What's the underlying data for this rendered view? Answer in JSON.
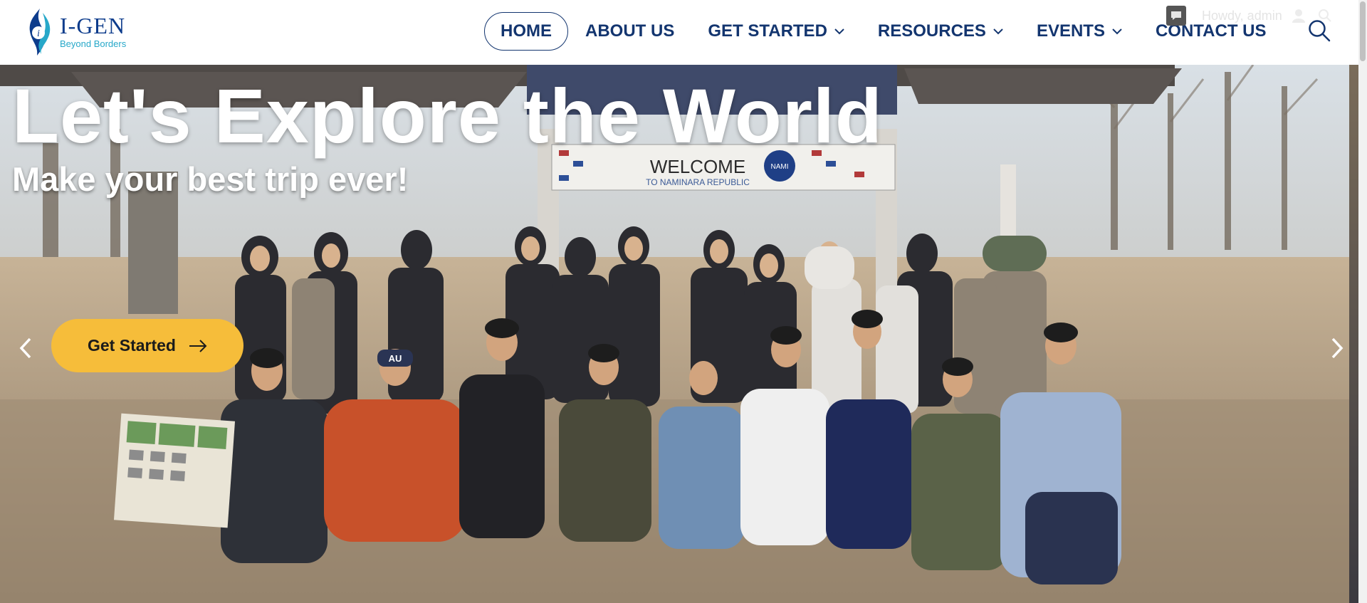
{
  "brand": {
    "name": "I-GEN",
    "tagline": "Beyond Borders"
  },
  "nav": {
    "items": [
      {
        "label": "HOME",
        "active": true
      },
      {
        "label": "ABOUT US",
        "has_dropdown": false
      },
      {
        "label": "GET STARTED",
        "has_dropdown": true
      },
      {
        "label": "RESOURCES",
        "has_dropdown": true
      },
      {
        "label": "EVENTS",
        "has_dropdown": true
      },
      {
        "label": "CONTACT US",
        "has_dropdown": false
      }
    ],
    "search_icon": "search-icon",
    "dropdown_icon": "chevron-down-icon"
  },
  "admin_bar": {
    "greeting": "Howdy, admin",
    "comment_icon": "comment-icon",
    "avatar_icon": "user-icon",
    "search_icon": "search-icon"
  },
  "hero": {
    "headline": "Let's Explore the World",
    "subheadline": "Make your best trip ever!",
    "cta_label": "Get Started",
    "cta_icon": "arrow-right-icon",
    "prev_icon": "chevron-left-icon",
    "next_icon": "chevron-right-icon",
    "banner": {
      "title": "WELCOME",
      "subtitle": "TO NAMINARA REPUBLIC",
      "seal": "NAMI"
    },
    "cap_text": "AU"
  },
  "colors": {
    "nav_text": "#13356f",
    "cta": "#f6bd3a",
    "logo_blue": "#0d3c8c",
    "logo_teal": "#27a8c9"
  }
}
